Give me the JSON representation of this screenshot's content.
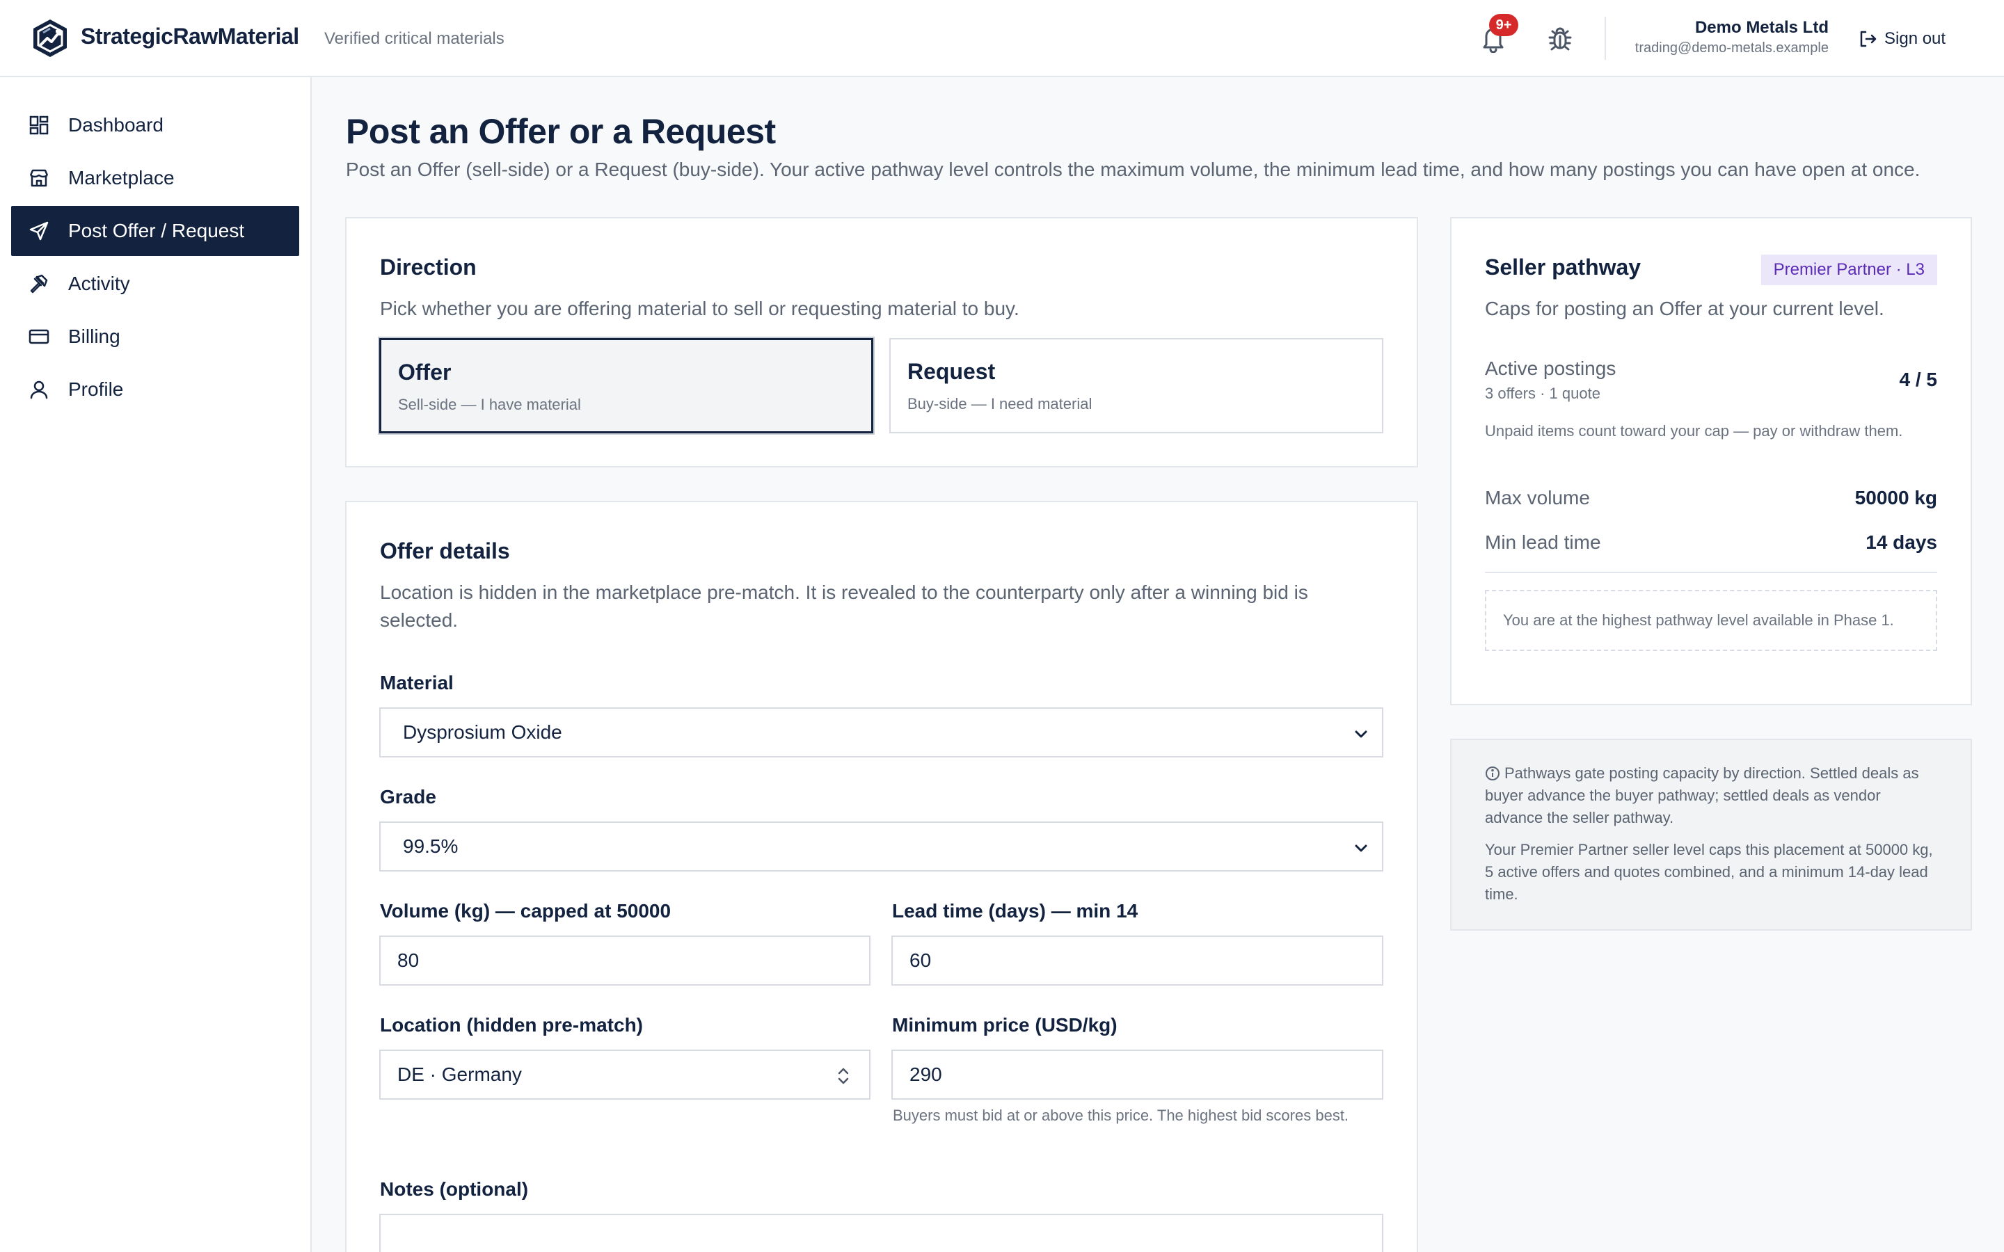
{
  "app": {
    "brand": "StrategicRawMaterial",
    "tagline": "Verified critical materials"
  },
  "header": {
    "notification_badge": "9+",
    "company": "Demo Metals Ltd",
    "email": "trading@demo-metals.example",
    "signout_label": "Sign out"
  },
  "sidebar": {
    "items": [
      {
        "label": "Dashboard",
        "icon": "grid-icon"
      },
      {
        "label": "Marketplace",
        "icon": "store-icon"
      },
      {
        "label": "Post Offer / Request",
        "icon": "send-icon",
        "active": true
      },
      {
        "label": "Activity",
        "icon": "gavel-icon"
      },
      {
        "label": "Billing",
        "icon": "card-icon"
      },
      {
        "label": "Profile",
        "icon": "user-icon"
      }
    ]
  },
  "page": {
    "title": "Post an Offer or a Request",
    "subtitle": "Post an Offer (sell-side) or a Request (buy-side). Your active pathway level controls the maximum volume, the minimum lead time, and how many postings you can have open at once."
  },
  "direction": {
    "title": "Direction",
    "subtitle": "Pick whether you are offering material to sell or requesting material to buy.",
    "options": [
      {
        "title": "Offer",
        "desc": "Sell-side — I have material",
        "selected": true
      },
      {
        "title": "Request",
        "desc": "Buy-side — I need material",
        "selected": false
      }
    ]
  },
  "offer": {
    "title": "Offer details",
    "subtitle": "Location is hidden in the marketplace pre-match. It is revealed to the counterparty only after a winning bid is selected.",
    "material_label": "Material",
    "material_value": "Dysprosium Oxide",
    "grade_label": "Grade",
    "grade_value": "99.5%",
    "volume_label": "Volume (kg) — capped at 50000",
    "volume_value": "80",
    "lead_label": "Lead time (days) — min 14",
    "lead_value": "60",
    "location_label": "Location (hidden pre-match)",
    "location_value": "DE · Germany",
    "price_label": "Minimum price (USD/kg)",
    "price_value": "290",
    "price_hint": "Buyers must bid at or above this price. The highest bid scores best.",
    "notes_label": "Notes (optional)",
    "notes_value": ""
  },
  "pathway": {
    "title": "Seller pathway",
    "badge": "Premier Partner · L3",
    "subtitle": "Caps for posting an Offer at your current level.",
    "active_label": "Active postings",
    "active_sub": "3 offers · 1 quote",
    "active_value": "4 / 5",
    "unpaid_note": "Unpaid items count toward your cap — pay or withdraw them.",
    "max_volume_label": "Max volume",
    "max_volume_value": "50000 kg",
    "min_lead_label": "Min lead time",
    "min_lead_value": "14 days",
    "highest_note": "You are at the highest pathway level available in Phase 1."
  },
  "info": {
    "para1": "Pathways gate posting capacity by direction. Settled deals as buyer advance the buyer pathway; settled deals as vendor advance the seller pathway.",
    "para2": "Your Premier Partner seller level caps this placement at 50000 kg, 5 active offers and quotes combined, and a minimum 14-day lead time."
  },
  "colors": {
    "navy": "#13233f",
    "badge_red": "#d62a2a",
    "pill_bg": "#ece6fb",
    "pill_text": "#5b2bb5"
  }
}
